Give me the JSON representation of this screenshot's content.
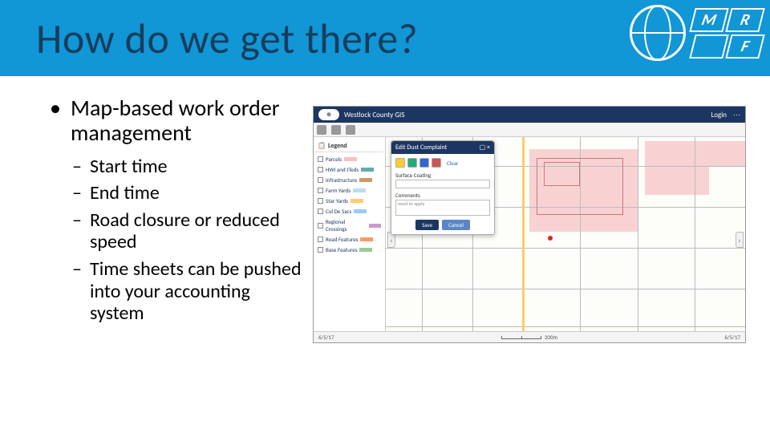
{
  "slide": {
    "title": "How do we get there?",
    "logo_letters": [
      "M",
      "R",
      "",
      "F"
    ]
  },
  "bullets": {
    "l1": "Map-based work order management",
    "l2": [
      "Start time",
      "End time",
      "Road closure or reduced speed",
      "Time sheets can be pushed into your accounting system"
    ]
  },
  "screenshot": {
    "app_title": "Westlock County GIS",
    "header_right": [
      "Login",
      "⋯"
    ],
    "sidebar": {
      "title": "Legend",
      "layers": [
        {
          "label": "Parcels",
          "color": "#f9c0c0"
        },
        {
          "label": "HWI and JTeds",
          "color": "#6aa"
        },
        {
          "label": "Infrastructure",
          "color": "#c96"
        },
        {
          "label": "Farm Yards",
          "color": "#bde"
        },
        {
          "label": "Star Yards",
          "color": "#fc6"
        },
        {
          "label": "Cul De Sacs",
          "color": "#9cf"
        },
        {
          "label": "Regional Crossings",
          "color": "#c9c"
        },
        {
          "label": "Road Features",
          "color": "#f96"
        },
        {
          "label": "Base Features",
          "color": "#9c9"
        }
      ]
    },
    "dialog": {
      "title": "Edit Dust Complaint",
      "clear": "Clear",
      "field1_label": "Surface Coating",
      "field1_value": "",
      "field2_label": "Comments",
      "field2_value": "need to apply",
      "save": "Save",
      "cancel": "Cancel"
    },
    "footer": {
      "left_date": "6/5/17",
      "scale_label": "200m",
      "right_date": "6/5/17"
    }
  }
}
